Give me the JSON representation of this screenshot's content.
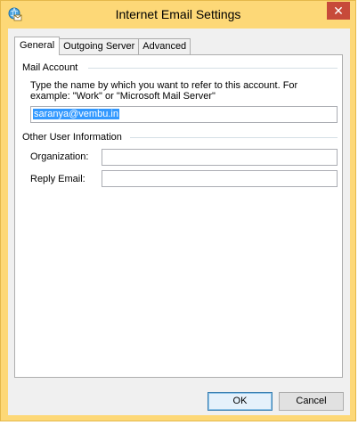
{
  "window": {
    "title": "Internet Email Settings",
    "close_glyph": "✕",
    "app_icon": "globe-envelope-icon"
  },
  "tabs": [
    {
      "label": "General",
      "active": true
    },
    {
      "label": "Outgoing Server",
      "active": false
    },
    {
      "label": "Advanced",
      "active": false
    }
  ],
  "mail_account": {
    "heading": "Mail Account",
    "description": "Type the name by which you want to refer to this account. For example: \"Work\" or \"Microsoft Mail Server\"",
    "value": "saranya@vembu.in"
  },
  "other_info": {
    "heading": "Other User Information",
    "organization_label": "Organization:",
    "organization_value": "",
    "reply_email_label": "Reply Email:",
    "reply_email_value": ""
  },
  "buttons": {
    "ok": "OK",
    "cancel": "Cancel"
  },
  "colors": {
    "title_bar": "#fdd877",
    "close_button": "#c74a3a",
    "selection": "#3399ff"
  }
}
